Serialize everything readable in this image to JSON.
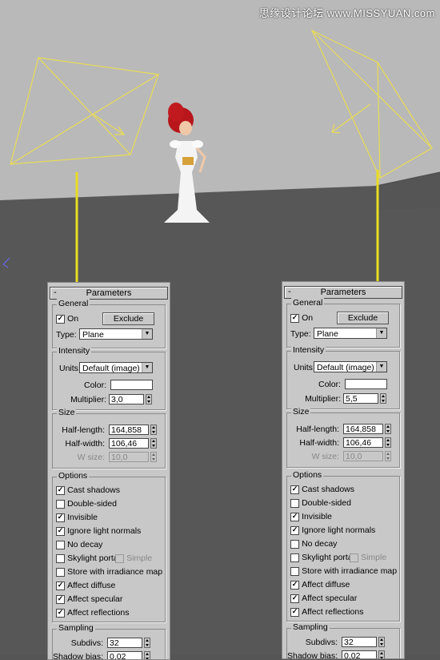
{
  "watermark": "思缘设计论坛 www.MISSYUAN.com",
  "panels": [
    {
      "rollout_title": "Parameters",
      "general": {
        "legend": "General",
        "on_label": "On",
        "on_checked": true,
        "exclude_label": "Exclude",
        "type_label": "Type:",
        "type_value": "Plane"
      },
      "intensity": {
        "legend": "Intensity",
        "units_label": "Units:",
        "units_value": "Default (image)",
        "color_label": "Color:",
        "multiplier_label": "Multiplier:",
        "multiplier_value": "3,0"
      },
      "size": {
        "legend": "Size",
        "half_length_label": "Half-length:",
        "half_length_value": "164,858",
        "half_width_label": "Half-width:",
        "half_width_value": "106,46",
        "w_size_label": "W size:",
        "w_size_value": "10,0"
      },
      "options": {
        "legend": "Options",
        "items": [
          {
            "label": "Cast shadows",
            "checked": true
          },
          {
            "label": "Double-sided",
            "checked": false
          },
          {
            "label": "Invisible",
            "checked": true
          },
          {
            "label": "Ignore light normals",
            "checked": true
          },
          {
            "label": "No decay",
            "checked": false
          },
          {
            "label": "Skylight portal",
            "checked": false
          },
          {
            "label": "Store with irradiance map",
            "checked": false
          },
          {
            "label": "Affect diffuse",
            "checked": true
          },
          {
            "label": "Affect specular",
            "checked": true
          },
          {
            "label": "Affect reflections",
            "checked": true
          }
        ],
        "simple_label": "Simple"
      },
      "sampling": {
        "legend": "Sampling",
        "subdivs_label": "Subdivs:",
        "subdivs_value": "32",
        "shadow_bias_label": "Shadow bias:",
        "shadow_bias_value": "0,02"
      }
    },
    {
      "rollout_title": "Parameters",
      "general": {
        "legend": "General",
        "on_label": "On",
        "on_checked": true,
        "exclude_label": "Exclude",
        "type_label": "Type:",
        "type_value": "Plane"
      },
      "intensity": {
        "legend": "Intensity",
        "units_label": "Units:",
        "units_value": "Default (image)",
        "color_label": "Color:",
        "multiplier_label": "Multiplier:",
        "multiplier_value": "5,5"
      },
      "size": {
        "legend": "Size",
        "half_length_label": "Half-length:",
        "half_length_value": "164,858",
        "half_width_label": "Half-width:",
        "half_width_value": "106,46",
        "w_size_label": "W size:",
        "w_size_value": "10,0"
      },
      "options": {
        "legend": "Options",
        "items": [
          {
            "label": "Cast shadows",
            "checked": true
          },
          {
            "label": "Double-sided",
            "checked": false
          },
          {
            "label": "Invisible",
            "checked": true
          },
          {
            "label": "Ignore light normals",
            "checked": true
          },
          {
            "label": "No decay",
            "checked": false
          },
          {
            "label": "Skylight portal",
            "checked": false
          },
          {
            "label": "Store with irradiance map",
            "checked": false
          },
          {
            "label": "Affect diffuse",
            "checked": true
          },
          {
            "label": "Affect specular",
            "checked": true
          },
          {
            "label": "Affect reflections",
            "checked": true
          }
        ],
        "simple_label": "Simple"
      },
      "sampling": {
        "legend": "Sampling",
        "subdivs_label": "Subdivs:",
        "subdivs_value": "32",
        "shadow_bias_label": "Shadow bias:",
        "shadow_bias_value": "0,02"
      }
    }
  ]
}
